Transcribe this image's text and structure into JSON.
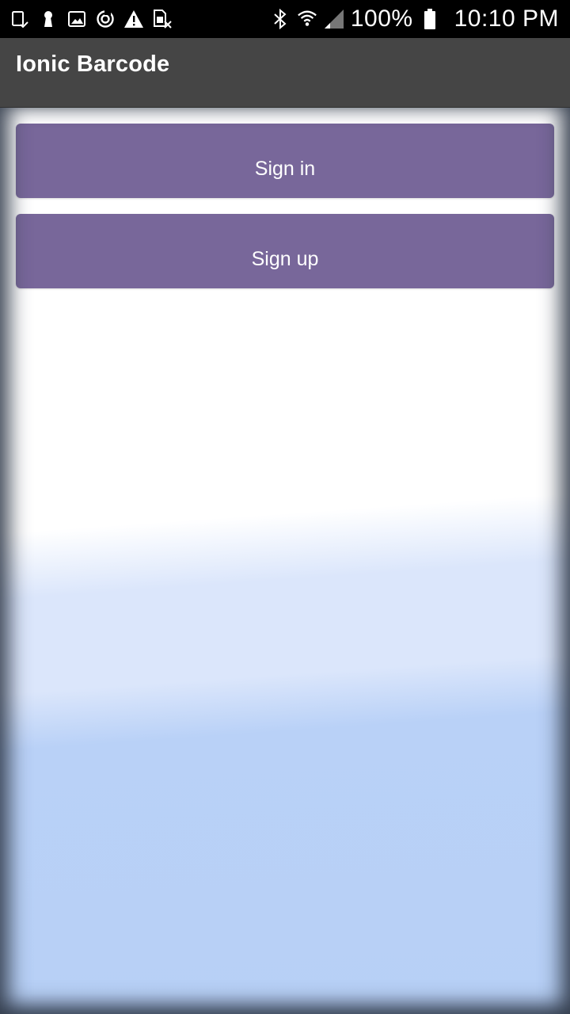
{
  "status_bar": {
    "left_icons": [
      "device-check-icon",
      "keyhole-icon",
      "image-icon",
      "sync-icon",
      "warning-icon",
      "sim-off-icon"
    ],
    "right_icons": [
      "bluetooth-icon",
      "wifi-icon",
      "signal-icon",
      "battery-icon"
    ],
    "battery": "100%",
    "time": "10:10 PM"
  },
  "toolbar": {
    "title": "Ionic Barcode"
  },
  "main": {
    "signin_label": "Sign in",
    "signup_label": "Sign up"
  },
  "colors": {
    "toolbar": "#454545",
    "button": "#78679a",
    "status_bar": "#000000"
  }
}
